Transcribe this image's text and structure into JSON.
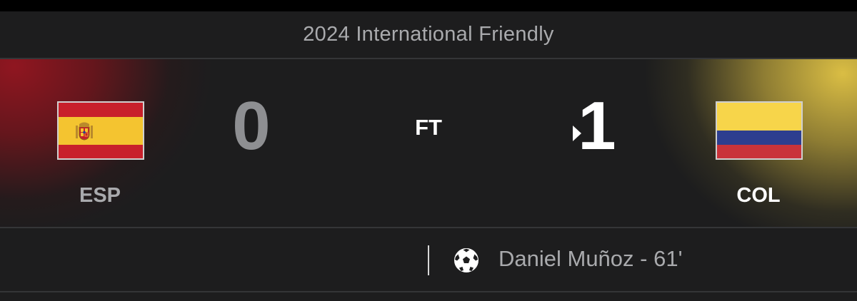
{
  "competition": {
    "title": "2024 International Friendly"
  },
  "match": {
    "status": "FT",
    "winner": "away"
  },
  "home": {
    "abbr": "ESP",
    "score": "0",
    "flag": "spain-flag",
    "colors": {
      "text": "#a9aaad",
      "score": "#8e8f92",
      "glow": "#961620"
    }
  },
  "away": {
    "abbr": "COL",
    "score": "1",
    "flag": "colombia-flag",
    "colors": {
      "text": "#ffffff",
      "score": "#ffffff",
      "glow": "#e4c646"
    }
  },
  "scorers": {
    "away": [
      {
        "text": "Daniel Muñoz - 61'",
        "icon": "soccer-ball-icon"
      }
    ]
  },
  "colors": {
    "background": "#1d1d1e",
    "divider": "#343537",
    "muted_text": "#a9aaad"
  }
}
